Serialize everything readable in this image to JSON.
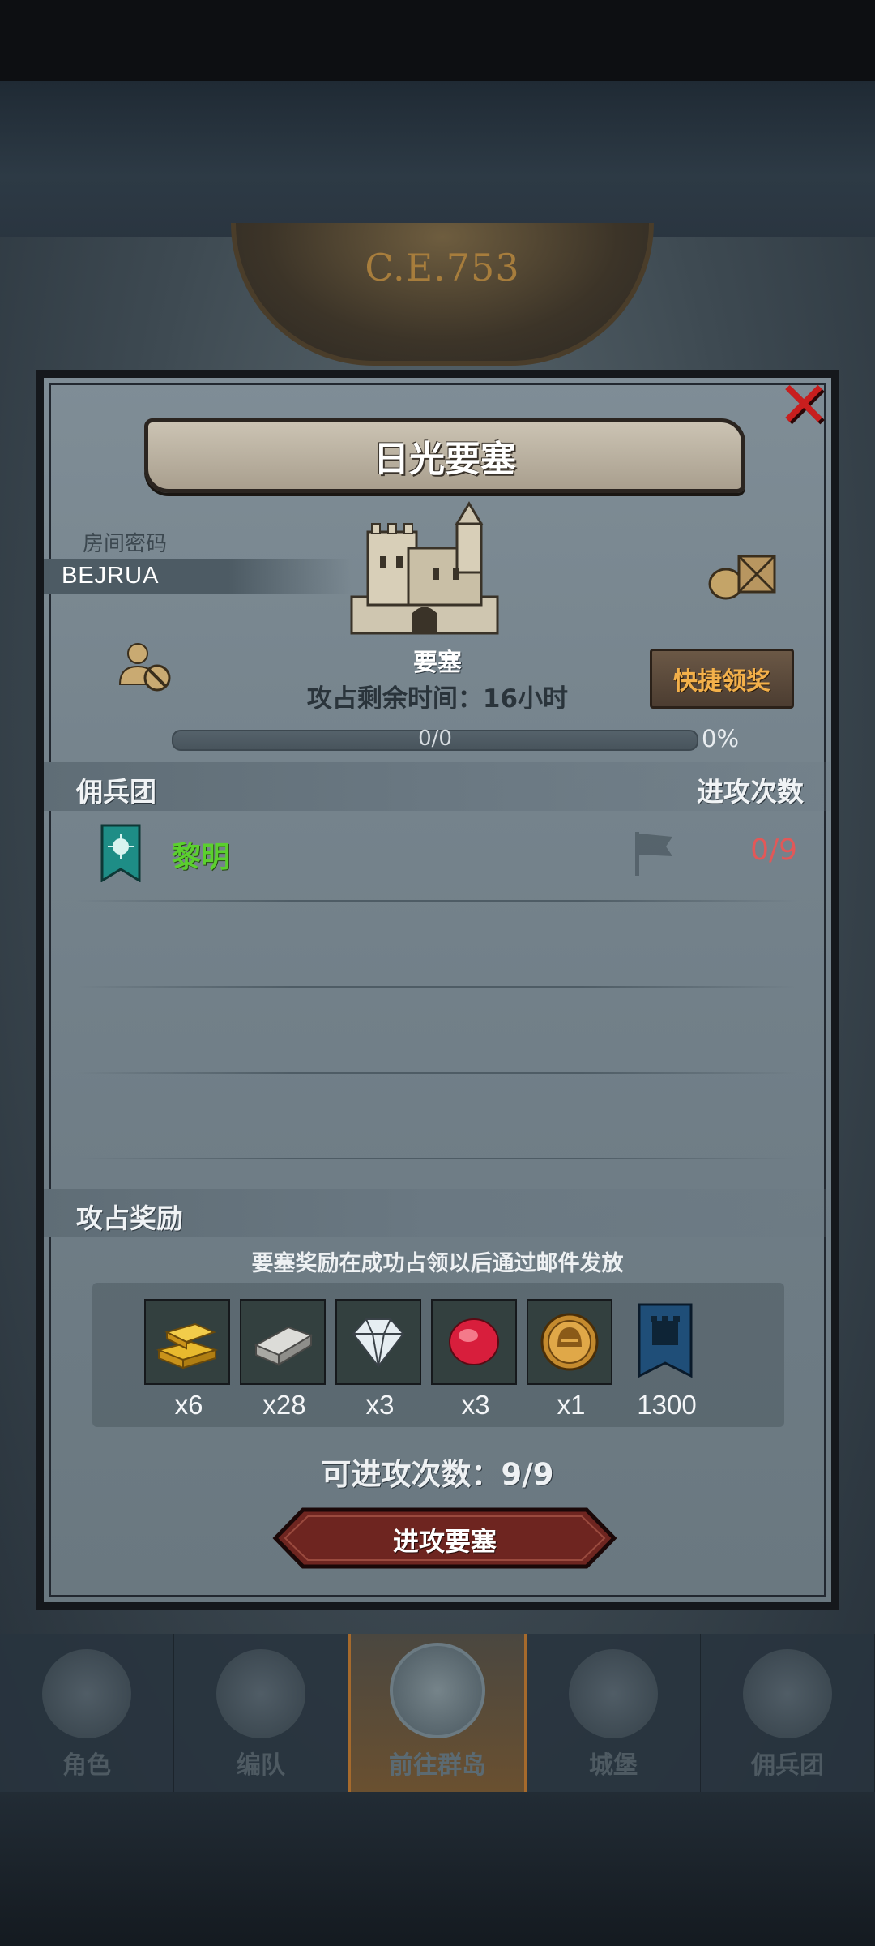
{
  "era": {
    "label": "C.E.753"
  },
  "dialog": {
    "title": "日光要塞",
    "room_label": "房间密码",
    "room_code": "BEJRUA",
    "fortress_name": "要塞",
    "quick_claim_label": "快捷领奖",
    "time_label": "攻占剩余时间：16小时",
    "progress": {
      "text": "0/0",
      "percent_label": "0%",
      "fraction": 0
    },
    "mercenary_header": {
      "left": "佣兵团",
      "right": "进攻次数"
    },
    "guilds": [
      {
        "name": "黎明",
        "attacks": "0/9",
        "banner_color": "#1e8d86"
      }
    ],
    "rewards_header": "攻占奖励",
    "reward_note": "要塞奖励在成功占领以后通过邮件发放",
    "rewards": [
      {
        "icon": "gold-bars-icon",
        "qty": "x6"
      },
      {
        "icon": "silver-ingot-icon",
        "qty": "x28"
      },
      {
        "icon": "diamond-icon",
        "qty": "x3"
      },
      {
        "icon": "ruby-icon",
        "qty": "x3"
      },
      {
        "icon": "helmet-coin-icon",
        "qty": "x1"
      },
      {
        "icon": "fortress-banner-icon",
        "qty": "1300"
      }
    ],
    "attempts_label": "可进攻次数：9/9",
    "attack_button": "进攻要塞"
  },
  "bottom_nav": [
    {
      "label": "角色"
    },
    {
      "label": "编队"
    },
    {
      "label": "前往群岛"
    },
    {
      "label": "城堡"
    },
    {
      "label": "佣兵团"
    }
  ],
  "colors": {
    "close": "#c81e1e",
    "guild_name": "#5bd02e",
    "attack_count": "#e25858",
    "quick_claim_text": "#f3b04a",
    "attack_button": "#7a2a24"
  }
}
